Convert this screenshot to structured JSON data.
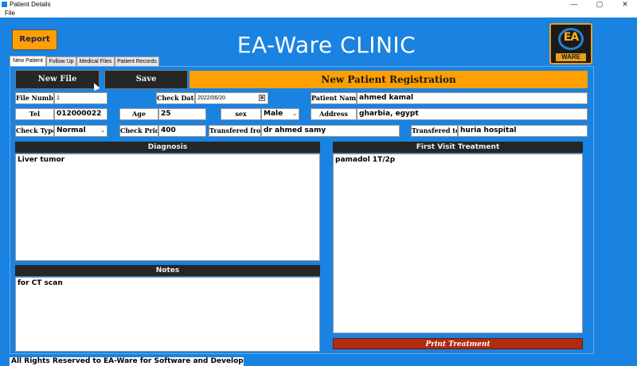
{
  "window": {
    "title": "Patient Details",
    "minimize": "—",
    "maximize": "▢",
    "close": "✕"
  },
  "menu": {
    "file": "File"
  },
  "header": {
    "report_label": "Report",
    "app_title": "EA-Ware CLINIC",
    "logo_letters": "EA",
    "logo_word": "WARE"
  },
  "tabs": [
    {
      "label": "New Patient",
      "active": true
    },
    {
      "label": "Follow Up",
      "active": false
    },
    {
      "label": "Medical Files",
      "active": false
    },
    {
      "label": "Patient Records",
      "active": false
    }
  ],
  "toolbar": {
    "new_file": "New File",
    "save": "Save",
    "banner": "New Patient Registration"
  },
  "form": {
    "file_number": {
      "label": "File Number",
      "value": "1"
    },
    "check_date": {
      "label": "Check Date",
      "value": "2022/06/20"
    },
    "patient_name": {
      "label": "Patient Name",
      "value": "ahmed kamal"
    },
    "tel": {
      "label": "Tel",
      "value": "012000022"
    },
    "age": {
      "label": "Age",
      "value": "25"
    },
    "sex": {
      "label": "sex",
      "value": "Male"
    },
    "address": {
      "label": "Address",
      "value": "gharbia, egypt"
    },
    "check_type": {
      "label": "Check Type",
      "value": "Normal"
    },
    "check_price": {
      "label": "Check Price",
      "value": "400"
    },
    "transfered_from": {
      "label": "Transfered from",
      "value": "dr ahmed samy"
    },
    "transfered_to": {
      "label": "Transfered to",
      "value": "huria hospital"
    }
  },
  "diagnosis": {
    "title": "Diagnosis",
    "text": "Liver tumor"
  },
  "notes": {
    "title": "Notes",
    "text": "for CT scan"
  },
  "treatment": {
    "title": "First Visit Treatment",
    "text": "pamadol 1T/2p",
    "print_label": "Print Treatment"
  },
  "footer": {
    "text": "All Rights Reserved to EA-Ware for Software and Development"
  },
  "colors": {
    "background": "#1a82e0",
    "accent": "#ff9f00",
    "dark": "#262626",
    "print": "#b42a0e"
  }
}
